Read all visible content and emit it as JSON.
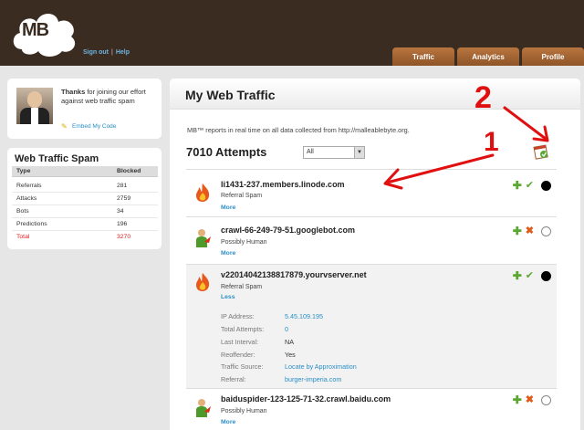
{
  "header": {
    "logo_text": "MB",
    "links": {
      "signout": "Sign out",
      "separator": "|",
      "help": "Help"
    },
    "tabs": [
      "Traffic",
      "Analytics",
      "Profile"
    ]
  },
  "welcome": {
    "bold": "Thanks",
    "text": " for joining our effort against web traffic spam",
    "embed": "Embed My Code"
  },
  "spam": {
    "title": "Web Traffic Spam",
    "columns": [
      "Type",
      "Blocked"
    ],
    "rows": [
      {
        "type": "Referrals",
        "blocked": "281"
      },
      {
        "type": "Attacks",
        "blocked": "2759"
      },
      {
        "type": "Bots",
        "blocked": "34"
      },
      {
        "type": "Predictions",
        "blocked": "196"
      },
      {
        "type": "Total",
        "blocked": "3270"
      }
    ]
  },
  "main": {
    "title": "My Web Traffic",
    "report": "MB™ reports in real time on all data collected from http://malleablebyte.org.",
    "attempts": "7010 Attempts",
    "filter": "All",
    "annotations": [
      "1",
      "2"
    ],
    "entries": [
      {
        "host": "li1431-237.members.linode.com",
        "type": "Referral Spam",
        "toggle": "More",
        "icon": "fire-icon",
        "status": "approved"
      },
      {
        "host": "crawl-66-249-79-51.googlebot.com",
        "type": "Possibly Human",
        "toggle": "More",
        "icon": "human-icon",
        "status": "rejected"
      },
      {
        "host": "v22014042138817879.yourvserver.net",
        "type": "Referral Spam",
        "toggle": "Less",
        "icon": "fire-icon",
        "status": "approved"
      },
      {
        "host": "baiduspider-123-125-71-32.crawl.baidu.com",
        "type": "Possibly Human",
        "toggle": "More",
        "icon": "human-icon",
        "status": "rejected"
      }
    ],
    "details": [
      {
        "label": "IP Address:",
        "value": "5.45.109.195",
        "link": true
      },
      {
        "label": "Total Attempts:",
        "value": "0",
        "link": true
      },
      {
        "label": "Last Interval:",
        "value": "NA",
        "link": false
      },
      {
        "label": "Reoffender:",
        "value": "Yes",
        "link": false
      },
      {
        "label": "Traffic Source:",
        "value": "Locate by Approximation",
        "link": true
      },
      {
        "label": "Referral:",
        "value": "burger-imperia.com",
        "link": true
      }
    ]
  },
  "colors": {
    "header": "#3a2c21",
    "tab": "#a4642f",
    "link": "#2a8fc6",
    "annotation": "#e01010",
    "accept": "#5aa832",
    "reject": "#e05a18"
  }
}
